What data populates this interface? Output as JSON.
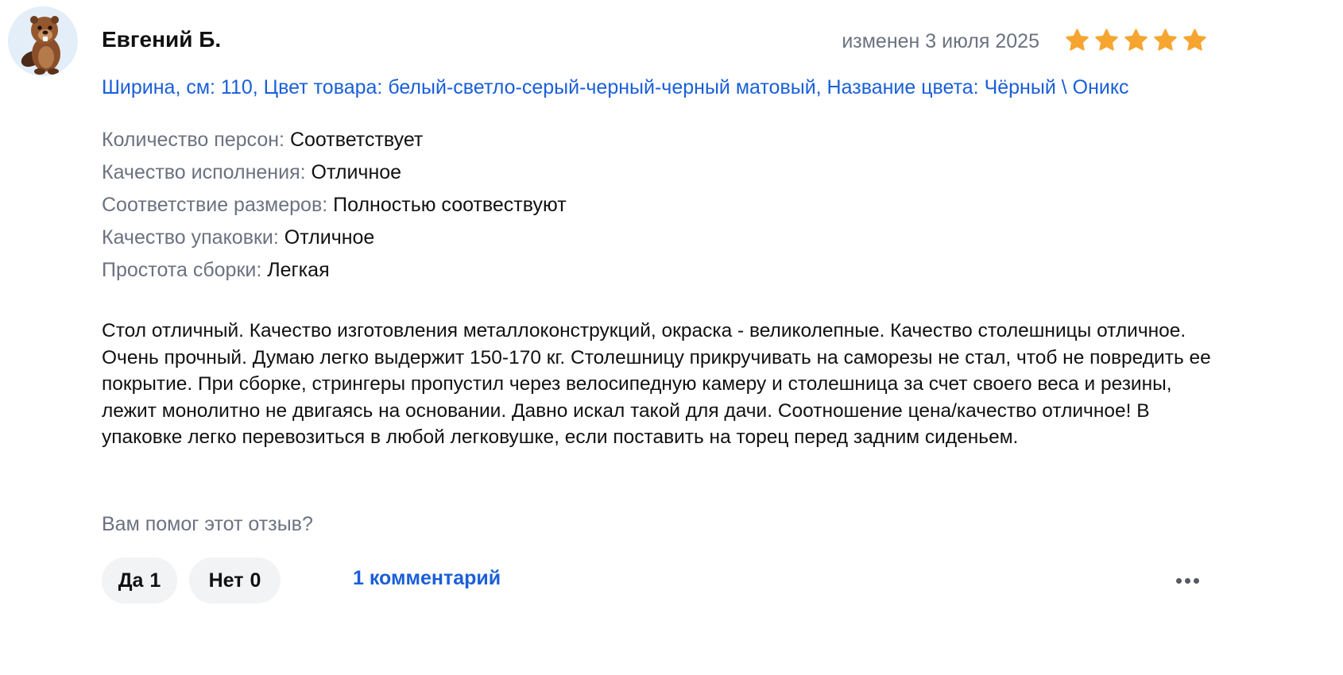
{
  "review": {
    "author": "Евгений Б.",
    "date": "изменен 3 июля 2025",
    "rating": 5,
    "rating_max": 5,
    "star_color": "#f6a531",
    "variant": "Ширина, см: 110, Цвет товара: белый-светло-серый-черный-черный матовый, Название цвета: Чёрный \\ Оникс",
    "properties": [
      {
        "key": "Количество персон:",
        "value": "Соответствует"
      },
      {
        "key": "Качество исполнения:",
        "value": "Отличное"
      },
      {
        "key": "Соответствие размеров:",
        "value": "Полностью соотвествуют"
      },
      {
        "key": "Качество упаковки:",
        "value": "Отличное"
      },
      {
        "key": "Простота сборки:",
        "value": "Легкая"
      }
    ],
    "text": "Стол отличный. Качество изготовления металлоконструкций, окраска - великолепные. Качество столешницы отличное. Очень прочный. Думаю легко выдержит 150-170 кг. Столешницу прикручивать на саморезы не стал, чтоб не повредить ее покрытие. При сборке, стрингеры пропустил через велосипедную камеру и столешница за счет своего веса и резины, лежит монолитно не двигаясь на основании. Давно искал такой для дачи. Соотношение цена/качество отличное! В упаковке легко перевозиться в любой легковушке, если поставить на торец перед задним сиденьем."
  },
  "feedback": {
    "question": "Вам помог этот отзыв?",
    "yes_label": "Да",
    "yes_count": "1",
    "no_label": "Нет",
    "no_count": "0",
    "comments_link": "1 комментарий"
  },
  "icons": {
    "avatar": "beaver-avatar",
    "star": "star-icon",
    "more": "more-dots-icon"
  },
  "colors": {
    "link": "#1a5fd8",
    "muted": "#6b7280",
    "button_bg": "#f1f3f5"
  }
}
